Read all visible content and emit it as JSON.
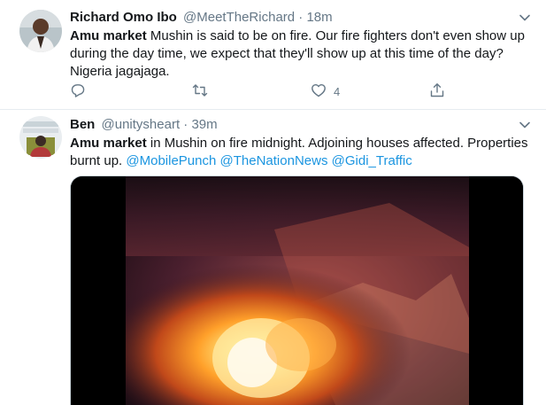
{
  "tweets": [
    {
      "author_name": "Richard Omo Ibo",
      "handle": "@MeetTheRichard",
      "separator": "·",
      "time": "18m",
      "text_bold": "Amu market",
      "text_rest": " Mushin is said to be on fire. Our fire fighters don't even show up during the day time, we expect that they'll show up at this time of the day? Nigeria jagajaga.",
      "reply_count": "",
      "retweet_count": "",
      "like_count": "4"
    },
    {
      "author_name": "Ben",
      "handle": "@unitysheart",
      "separator": "·",
      "time": "39m",
      "text_bold": "Amu market",
      "text_rest": " in Mushin on fire midnight. Adjoining houses affected. Properties burnt up. ",
      "mentions": [
        "@MobilePunch",
        "@TheNationNews",
        "@Gidi_Traffic"
      ]
    }
  ],
  "icons": {
    "caret": "chevron-down-icon",
    "reply": "reply-icon",
    "retweet": "retweet-icon",
    "like": "heart-icon",
    "share": "share-icon"
  },
  "colors": {
    "text": "#14171a",
    "secondary": "#657786",
    "link": "#1b95e0",
    "divider": "#e6ecf0"
  }
}
